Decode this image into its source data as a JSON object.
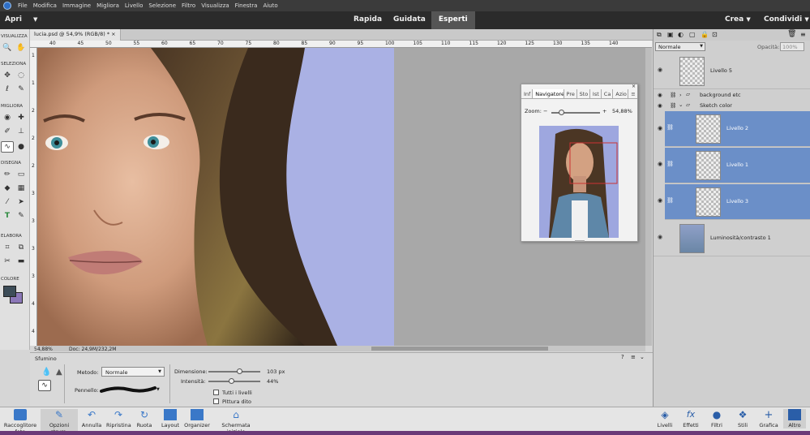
{
  "menu": [
    "File",
    "Modifica",
    "Immagine",
    "Migliora",
    "Livello",
    "Selezione",
    "Filtro",
    "Visualizza",
    "Finestra",
    "Aiuto"
  ],
  "modebar": {
    "open": "Apri",
    "modes": [
      "Rapida",
      "Guidata",
      "Esperti"
    ],
    "active": "Esperti",
    "crea": "Crea",
    "condividi": "Condividi"
  },
  "toolbox": {
    "sections": [
      "VISUALIZZA",
      "SELEZIONA",
      "MIGLIORA",
      "DISEGNA",
      "ELABORA",
      "COLORE"
    ]
  },
  "document": {
    "tab_title": "lucia.psd @ 54,9% (RGB/8) *",
    "close": "×",
    "ruler_h": [
      "40",
      "45",
      "50",
      "55",
      "60",
      "65",
      "70",
      "75",
      "80",
      "85",
      "90",
      "95",
      "100",
      "105",
      "110",
      "115",
      "120",
      "125",
      "130",
      "135",
      "140"
    ],
    "ruler_v": [
      "1",
      "1",
      "2",
      "2",
      "2",
      "3",
      "3",
      "3",
      "3",
      "4",
      "4"
    ],
    "zoom_status": "54,88%",
    "doc_status": "Doc: 24,9M/232,2M",
    "foreground_color": "#3d4d58",
    "background_color": "#8c78b8"
  },
  "navigator": {
    "tabs": [
      "Inf",
      "Navigatore",
      "Pre",
      "Sto",
      "Ist",
      "Ca",
      "Azio"
    ],
    "active_tab": "Navigatore",
    "zoom_label": "Zoom:",
    "minus": "−",
    "plus": "+",
    "zoom_value": "54,88%",
    "zoom_slider_fraction": 0.2
  },
  "options": {
    "tool_name": "Sfumino",
    "metodo_label": "Metodo:",
    "metodo_value": "Normale",
    "pennello_label": "Pennello:",
    "dimensione_label": "Dimensione:",
    "dimensione_value": "103 px",
    "dimensione_fraction": 0.6,
    "intensita_label": "Intensità:",
    "intensita_value": "44%",
    "intensita_fraction": 0.44,
    "tutti_livelli": "Tutti i livelli",
    "pittura_dito": "Pittura dito"
  },
  "layers_panel": {
    "blend_mode": "Normale",
    "opacity_label": "Opacità:",
    "opacity_value": "100%",
    "layers": [
      {
        "name": "Livello 5",
        "selected": false
      },
      {
        "name": "Livello 2",
        "selected": true
      },
      {
        "name": "Livello 1",
        "selected": true
      },
      {
        "name": "Livello 3",
        "selected": true
      },
      {
        "name": "Luminosità/contrasto 1",
        "selected": false
      }
    ],
    "groups": [
      {
        "name": "background etc"
      },
      {
        "name": "Sketch color"
      }
    ]
  },
  "bottom_left": [
    "Raccoglitore foto",
    "Opzioni strum.",
    "Annulla",
    "Ripristina",
    "Ruota",
    "Layout",
    "Organizer",
    "Schermata iniziale"
  ],
  "bottom_right": [
    "Livelli",
    "Effetti",
    "Filtri",
    "Stili",
    "Grafica",
    "Altro"
  ],
  "colors": {
    "accent": "#6b8fc8",
    "menubar": "#3b3b3b",
    "modebar": "#2b2b2b",
    "bottom_strip": "#6a3a78"
  }
}
